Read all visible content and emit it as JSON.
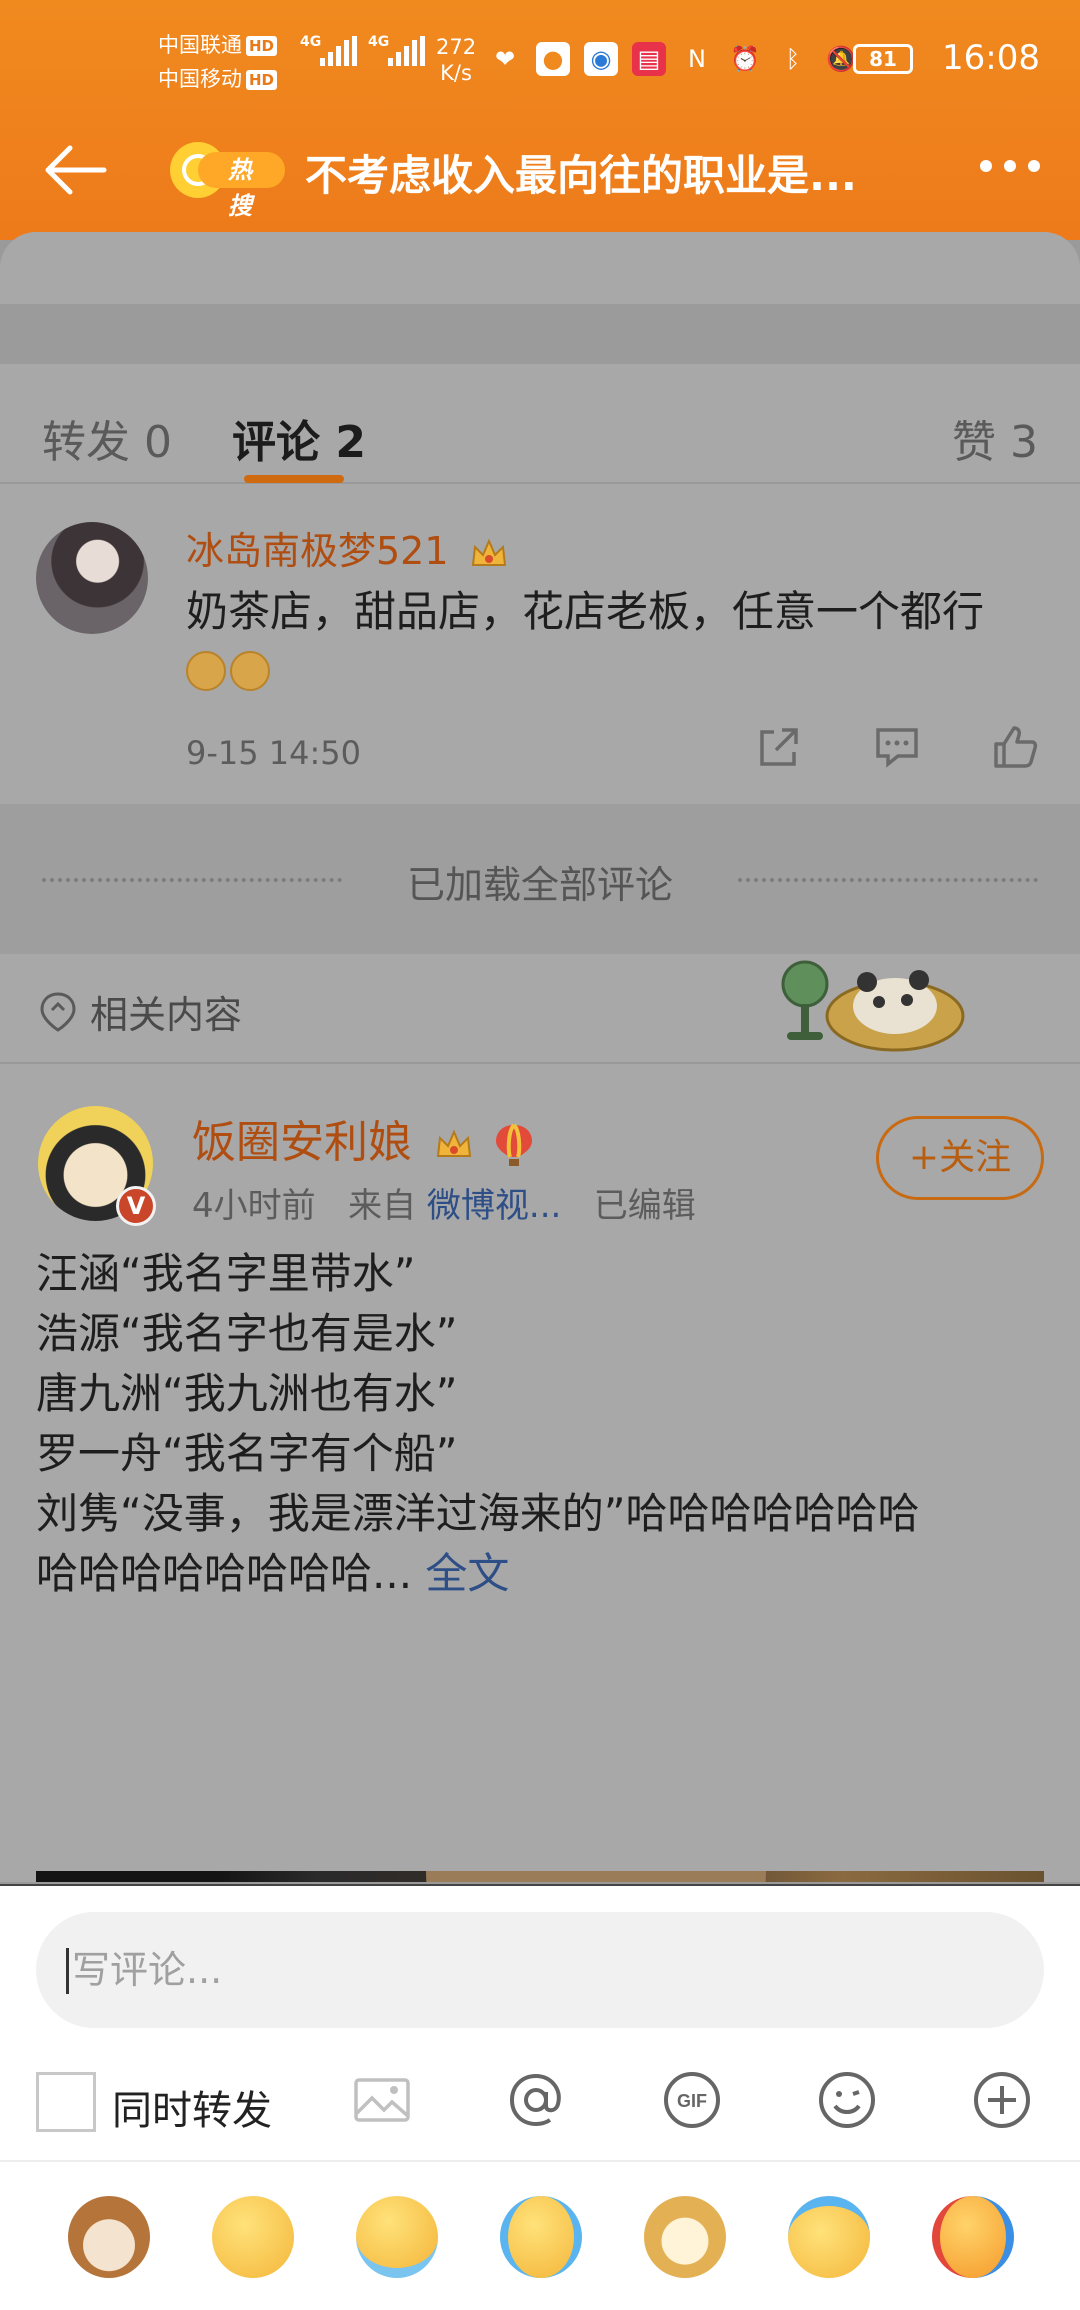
{
  "status_bar": {
    "carrier1": "中国联通",
    "carrier2": "中国移动",
    "hd": "HD",
    "net1": "4G",
    "net2": "4G",
    "speed_value": "272",
    "speed_unit": "K/s",
    "battery": "81",
    "time": "16:08"
  },
  "header": {
    "hot_tag": "热搜",
    "title": "不考虑收入最向往的职业是..."
  },
  "tabs": {
    "repost": "转发 0",
    "comments": "评论 2",
    "likes": "赞 3"
  },
  "comment": {
    "user": "冰岛南极梦521",
    "text": "奶茶店，甜品店，花店老板，任意一个都行",
    "time": "9-15 14:50"
  },
  "loaded_text": "已加载全部评论",
  "related_label": "相关内容",
  "post": {
    "user": "饭圈安利娘",
    "time": "4小时前",
    "from_prefix": "来自",
    "source": "微博视...",
    "edited": "已编辑",
    "follow": "+关注",
    "verified": "V",
    "lines": [
      "汪涵“我名字里带水”",
      "浩源“我名字也有是水”",
      "唐九洲“我九洲也有水”",
      "罗一舟“我名字有个船”",
      "刘隽“没事，我是漂洋过海来的”哈哈哈哈哈哈哈",
      "哈哈哈哈哈哈哈哈..."
    ],
    "more": "全文"
  },
  "composer": {
    "placeholder": "写评论...",
    "repost_label": "同时转发",
    "tool_icons": [
      "image-icon",
      "at-icon",
      "gif-icon",
      "emoji-icon",
      "plus-icon"
    ],
    "emojis": [
      "cat-emoji",
      "shush-emoji",
      "laugh-tears-emoji",
      "crying-emoji",
      "doge-emoji",
      "facepalm-laugh-emoji",
      "cheering-emoji"
    ]
  },
  "colors": {
    "accent": "#ee7a1a",
    "username": "#b04d10",
    "link": "#2d4e86"
  }
}
